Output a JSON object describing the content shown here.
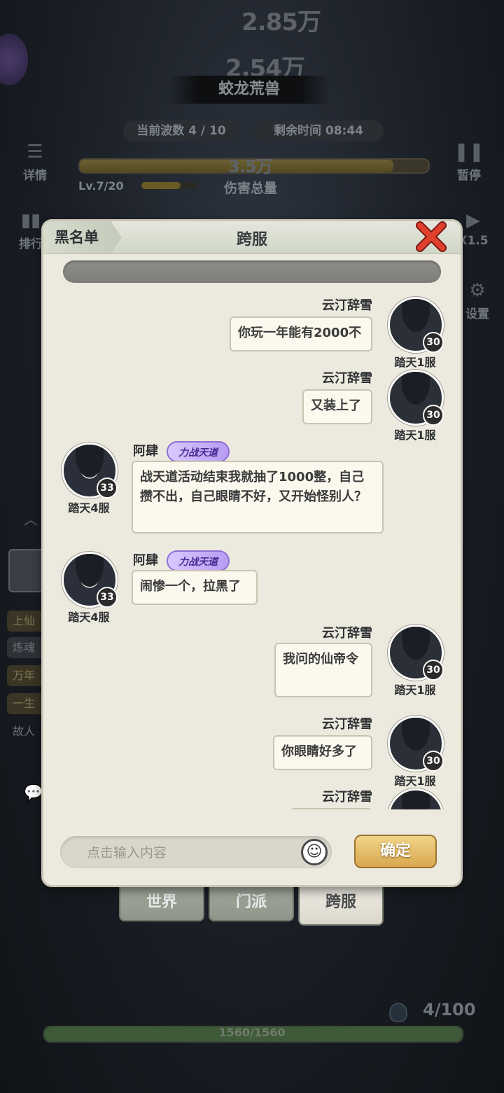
{
  "hud": {
    "val_top": "2.85万",
    "val_mid": "2.54万",
    "boss_name": "蛟龙荒兽",
    "wave": "当前波数 4 / 10",
    "remaining": "剩余时间 08:44",
    "val_damage": "3.5万",
    "level": "Lv.7/20",
    "damage_label": "伤害总量",
    "details_label": "详情",
    "pause_label": "暂停",
    "rank_label": "排行",
    "speed_label": "X1.5",
    "setting_label": "设置",
    "wave_progress": 0.9,
    "level_progress": 0.7,
    "side_tags": [
      "上仙",
      "炼魂",
      "万年",
      "一生",
      "故人"
    ],
    "unit_count": "4/100",
    "hp_text": "1560/1560",
    "hp_progress": 1.0
  },
  "modal": {
    "blacklist_label": "黑名单",
    "title": "跨服",
    "input_placeholder": "点击输入内容",
    "confirm_label": "确定"
  },
  "messages": [
    {
      "side": "right",
      "sender": "云汀辞雪",
      "server": "踏天1服",
      "level": "30",
      "text": "你玩一年能有2000不"
    },
    {
      "side": "right",
      "sender": "云汀辞雪",
      "server": "踏天1服",
      "level": "30",
      "text": "又装上了"
    },
    {
      "side": "left",
      "sender": "阿肆",
      "server": "踏天4服",
      "level": "33",
      "badge": "力战天道",
      "text": "战天道活动结束我就抽了1000整，自己攒不出，自己眼睛不好，又开始怪别人？"
    },
    {
      "side": "left",
      "sender": "阿肆",
      "server": "踏天4服",
      "level": "33",
      "badge": "力战天道",
      "text": "闹惨一个，拉黑了"
    },
    {
      "side": "right",
      "sender": "云汀辞雪",
      "server": "踏天1服",
      "level": "30",
      "text": "我问的仙帝令"
    },
    {
      "side": "right",
      "sender": "云汀辞雪",
      "server": "踏天1服",
      "level": "30",
      "text": "你眼睛好多了"
    },
    {
      "side": "right",
      "sender": "云汀辞雪",
      "server": "",
      "level": "",
      "text": ""
    }
  ],
  "tabs": [
    {
      "label": "世界"
    },
    {
      "label": "门派"
    },
    {
      "label": "跨服"
    }
  ]
}
